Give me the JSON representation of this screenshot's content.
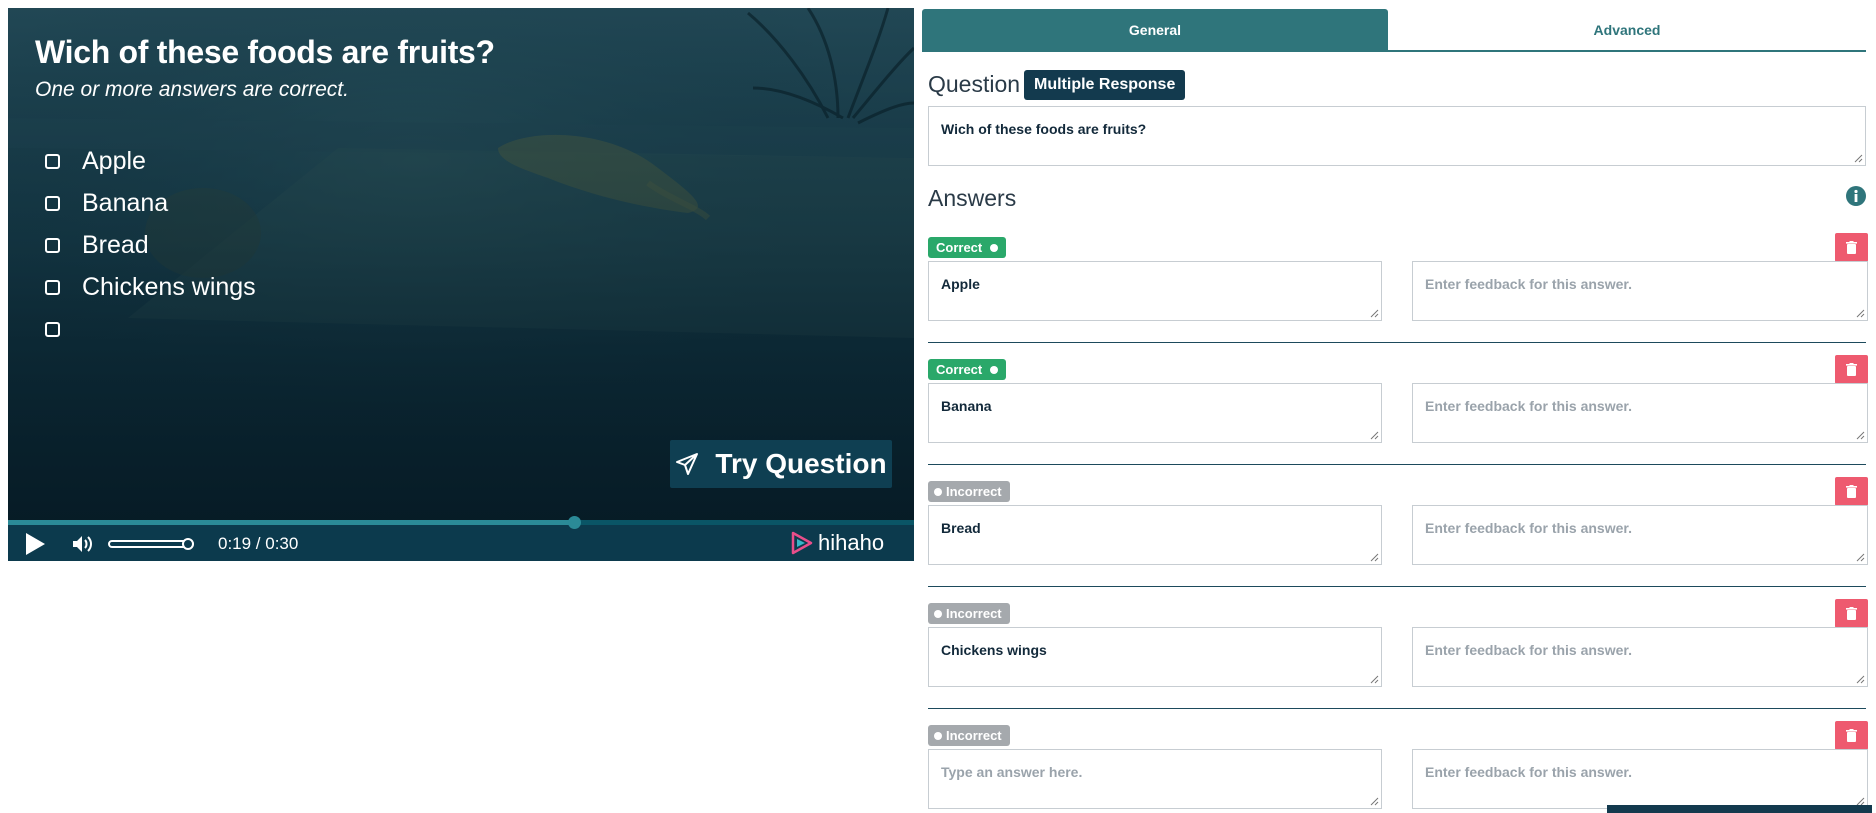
{
  "player": {
    "question_title": "Wich of these foods are fruits?",
    "question_subtitle": "One or more answers are correct.",
    "options": [
      "Apple",
      "Banana",
      "Bread",
      "Chickens wings",
      ""
    ],
    "try_button_label": "Try Question",
    "time_display": "0:19 / 0:30",
    "progress_fraction": 0.625,
    "volume_fraction": 1.0,
    "brand": "hihaho",
    "icons": {
      "play": "play-icon",
      "volume": "volume-icon",
      "send": "paper-plane-icon",
      "logo": "hihaho-logo-icon"
    }
  },
  "editor": {
    "tabs": [
      {
        "label": "General",
        "active": true
      },
      {
        "label": "Advanced",
        "active": false
      }
    ],
    "question_label": "Question",
    "question_type_badge": "Multiple Response",
    "question_text": "Wich of these foods are fruits?",
    "answers_label": "Answers",
    "answer_placeholder": "Type an answer here.",
    "feedback_placeholder": "Enter feedback for this answer.",
    "answers": [
      {
        "status": "Correct",
        "text": "Apple",
        "feedback": ""
      },
      {
        "status": "Correct",
        "text": "Banana",
        "feedback": ""
      },
      {
        "status": "Incorrect",
        "text": "Bread",
        "feedback": ""
      },
      {
        "status": "Incorrect",
        "text": "Chickens wings",
        "feedback": ""
      },
      {
        "status": "Incorrect",
        "text": "",
        "feedback": ""
      }
    ]
  },
  "colors": {
    "accent_teal": "#2f757b",
    "badge_navy": "#133a4e",
    "correct_green": "#2aa86a",
    "incorrect_gray": "#a5a9ad",
    "delete_red": "#ee5a6f"
  }
}
